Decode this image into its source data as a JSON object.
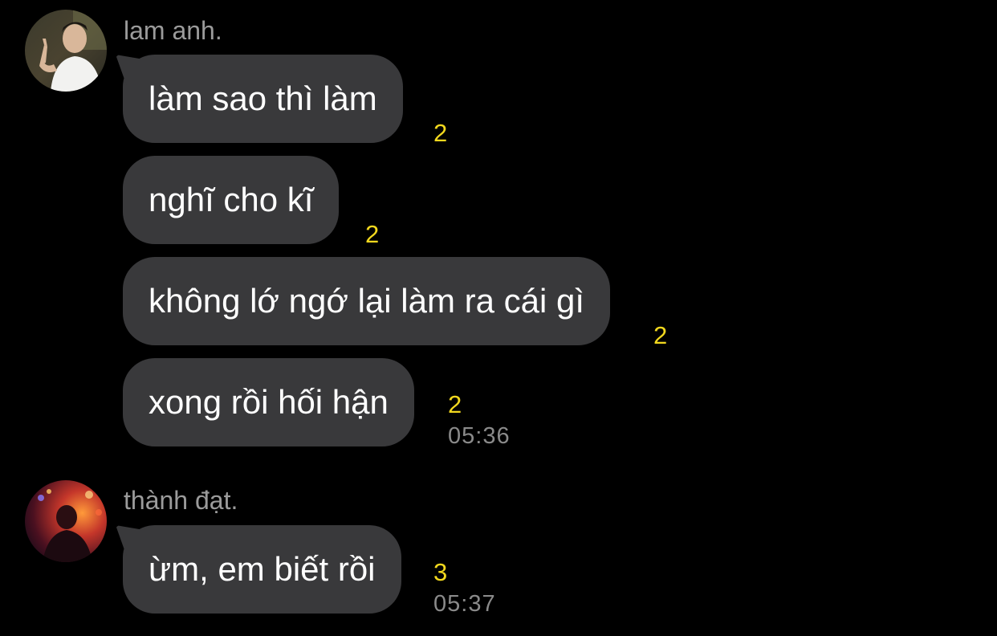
{
  "messages": [
    {
      "sender": "lam anh.",
      "avatar_icon": "user-avatar-photo",
      "bubbles": [
        {
          "text": "làm sao thì làm",
          "read_count": "2"
        },
        {
          "text": "nghĩ cho kĩ",
          "read_count": "2"
        },
        {
          "text": "không lớ ngớ lại làm ra cái gì",
          "read_count": "2"
        },
        {
          "text": "xong rồi hối hận",
          "read_count": "2",
          "time": "05:36"
        }
      ]
    },
    {
      "sender": "thành đạt.",
      "avatar_icon": "user-avatar-photo",
      "bubbles": [
        {
          "text": "ừm, em biết rồi",
          "read_count": "3",
          "time": "05:37"
        }
      ]
    }
  ],
  "colors": {
    "background": "#000000",
    "bubble": "#39393b",
    "unread_count": "#f2d81e",
    "timestamp": "#8a8a8a",
    "sender_name": "#9b9b9b"
  }
}
